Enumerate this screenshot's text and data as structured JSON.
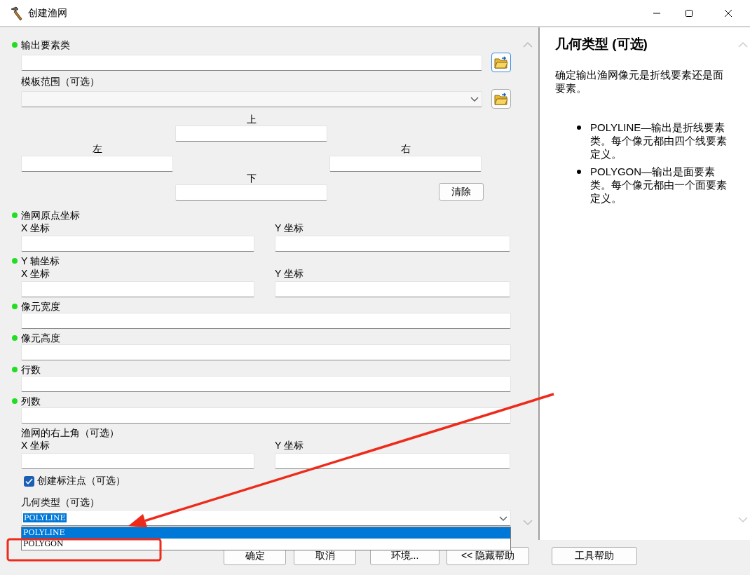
{
  "window": {
    "title": "创建渔网"
  },
  "parameters": [
    {
      "kind": "text",
      "label": "输出要素类",
      "required": true,
      "browse": true
    },
    {
      "kind": "combo",
      "label": "模板范围（可选）",
      "required": false,
      "browse": true
    },
    {
      "kind": "extent",
      "top": "上",
      "left": "左",
      "right": "右",
      "bottom": "下",
      "clear": "清除"
    },
    {
      "kind": "xy",
      "label": "渔网原点坐标",
      "required": true,
      "x": "X 坐标",
      "y": "Y 坐标"
    },
    {
      "kind": "xy",
      "label": "Y 轴坐标",
      "required": true,
      "x": "X 坐标",
      "y": "Y 坐标"
    },
    {
      "kind": "text",
      "label": "像元宽度",
      "required": true,
      "browse": false
    },
    {
      "kind": "text",
      "label": "像元高度",
      "required": true,
      "browse": false
    },
    {
      "kind": "text",
      "label": "行数",
      "required": true,
      "browse": false
    },
    {
      "kind": "text",
      "label": "列数",
      "required": true,
      "browse": false
    },
    {
      "kind": "xy",
      "label": "渔网的右上角（可选）",
      "required": false,
      "x": "X 坐标",
      "y": "Y 坐标"
    },
    {
      "kind": "checkbox",
      "label": "创建标注点（可选）",
      "checked": true
    },
    {
      "kind": "dropdown",
      "label": "几何类型（可选）",
      "value": "POLYLINE",
      "expanded": true,
      "options": [
        {
          "label": "POLYLINE",
          "selected": true
        },
        {
          "label": "POLYGON",
          "selected": false
        }
      ]
    }
  ],
  "buttons": [
    "确定",
    "取消",
    "环境...",
    "<< 隐藏帮助",
    "工具帮助"
  ],
  "help": {
    "title": "几何类型 (可选)",
    "description": "确定输出渔网像元是折线要素还是面要素。",
    "bullets": [
      "POLYLINE—输出是折线要素类。每个像元都由四个线要素定义。",
      "POLYGON—输出是面要素类。每个像元都由一个面要素定义。"
    ]
  }
}
